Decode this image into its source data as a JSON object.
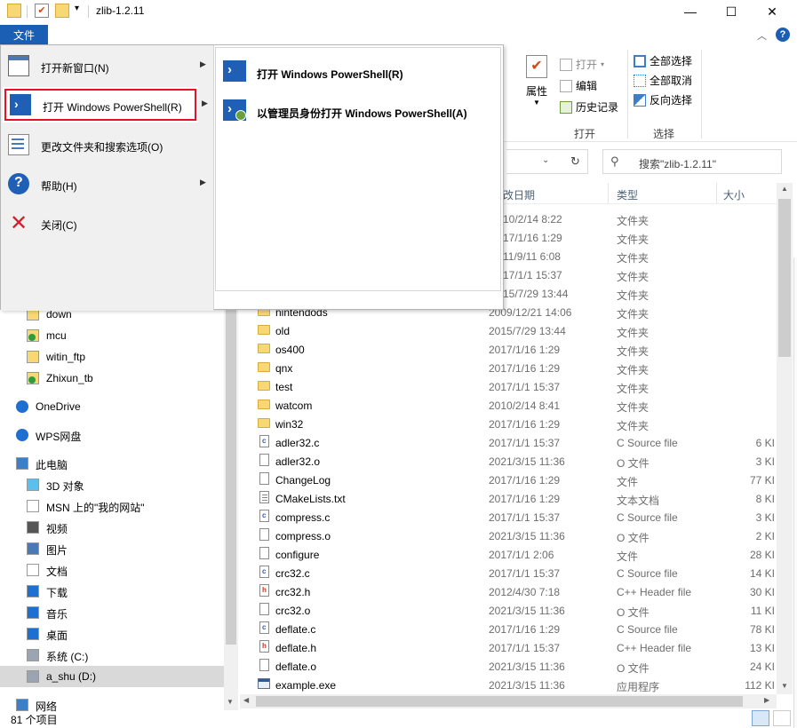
{
  "window": {
    "title": "zlib-1.2.11",
    "controls": {
      "minimize": "—",
      "maximize": "☐",
      "close": "✕"
    }
  },
  "ribbon": {
    "file_tab": "文件",
    "groups": [
      {
        "label": "打开"
      },
      {
        "label": "选择"
      }
    ],
    "properties": "属性",
    "open": "打开",
    "edit": "编辑",
    "history": "历史记录",
    "select_all": "全部选择",
    "select_none": "全部取消",
    "invert": "反向选择"
  },
  "address": {
    "search_placeholder": "搜索\"zlib-1.2.11\""
  },
  "columns": {
    "date": "改日期",
    "type": "类型",
    "size": "大小"
  },
  "file_menu": {
    "items": [
      {
        "label": "打开新窗口(N)",
        "icon": "new-window-icon",
        "has_submenu": true
      },
      {
        "label": "打开 Windows PowerShell(R)",
        "icon": "powershell-icon",
        "has_submenu": true,
        "selected": true
      },
      {
        "label": "更改文件夹和搜索选项(O)",
        "icon": "folder-options-icon",
        "has_submenu": false
      },
      {
        "label": "帮助(H)",
        "icon": "help-icon",
        "has_submenu": true
      },
      {
        "label": "关闭(C)",
        "icon": "close-icon",
        "has_submenu": false
      }
    ],
    "submenu": [
      {
        "label": "打开 Windows PowerShell(R)",
        "icon": "powershell-icon"
      },
      {
        "label": "以管理员身份打开 Windows PowerShell(A)",
        "icon": "powershell-admin-icon"
      }
    ]
  },
  "rows": [
    {
      "name": "",
      "date": "10/2/14 8:22",
      "type": "文件夹",
      "size": "",
      "kind": "folder",
      "partial": true
    },
    {
      "name": "",
      "date": "17/1/16 1:29",
      "type": "文件夹",
      "size": "",
      "kind": "folder",
      "partial": true
    },
    {
      "name": "",
      "date": "11/9/11 6:08",
      "type": "文件夹",
      "size": "",
      "kind": "folder",
      "partial": true
    },
    {
      "name": "",
      "date": "17/1/1 15:37",
      "type": "文件夹",
      "size": "",
      "kind": "folder",
      "partial": true
    },
    {
      "name": "",
      "date": "15/7/29 13:44",
      "type": "文件夹",
      "size": "",
      "kind": "folder",
      "partial": true
    },
    {
      "name": "nintendods",
      "date": "2009/12/21 14:06",
      "type": "文件夹",
      "size": "",
      "kind": "folder"
    },
    {
      "name": "old",
      "date": "2015/7/29 13:44",
      "type": "文件夹",
      "size": "",
      "kind": "folder"
    },
    {
      "name": "os400",
      "date": "2017/1/16 1:29",
      "type": "文件夹",
      "size": "",
      "kind": "folder"
    },
    {
      "name": "qnx",
      "date": "2017/1/16 1:29",
      "type": "文件夹",
      "size": "",
      "kind": "folder"
    },
    {
      "name": "test",
      "date": "2017/1/1 15:37",
      "type": "文件夹",
      "size": "",
      "kind": "folder"
    },
    {
      "name": "watcom",
      "date": "2010/2/14 8:41",
      "type": "文件夹",
      "size": "",
      "kind": "folder"
    },
    {
      "name": "win32",
      "date": "2017/1/16 1:29",
      "type": "文件夹",
      "size": "",
      "kind": "folder"
    },
    {
      "name": "adler32.c",
      "date": "2017/1/1 15:37",
      "type": "C Source file",
      "size": "6 KI",
      "kind": "c"
    },
    {
      "name": "adler32.o",
      "date": "2021/3/15 11:36",
      "type": "O 文件",
      "size": "3 KI",
      "kind": "file"
    },
    {
      "name": "ChangeLog",
      "date": "2017/1/16 1:29",
      "type": "文件",
      "size": "77 KI",
      "kind": "file"
    },
    {
      "name": "CMakeLists.txt",
      "date": "2017/1/16 1:29",
      "type": "文本文档",
      "size": "8 KI",
      "kind": "txt"
    },
    {
      "name": "compress.c",
      "date": "2017/1/1 15:37",
      "type": "C Source file",
      "size": "3 KI",
      "kind": "c"
    },
    {
      "name": "compress.o",
      "date": "2021/3/15 11:36",
      "type": "O 文件",
      "size": "2 KI",
      "kind": "file"
    },
    {
      "name": "configure",
      "date": "2017/1/1 2:06",
      "type": "文件",
      "size": "28 KI",
      "kind": "file"
    },
    {
      "name": "crc32.c",
      "date": "2017/1/1 15:37",
      "type": "C Source file",
      "size": "14 KI",
      "kind": "c"
    },
    {
      "name": "crc32.h",
      "date": "2012/4/30 7:18",
      "type": "C++ Header file",
      "size": "30 KI",
      "kind": "h"
    },
    {
      "name": "crc32.o",
      "date": "2021/3/15 11:36",
      "type": "O 文件",
      "size": "11 KI",
      "kind": "file"
    },
    {
      "name": "deflate.c",
      "date": "2017/1/16 1:29",
      "type": "C Source file",
      "size": "78 KI",
      "kind": "c"
    },
    {
      "name": "deflate.h",
      "date": "2017/1/1 15:37",
      "type": "C++ Header file",
      "size": "13 KI",
      "kind": "h"
    },
    {
      "name": "deflate.o",
      "date": "2021/3/15 11:36",
      "type": "O 文件",
      "size": "24 KI",
      "kind": "file"
    },
    {
      "name": "example.exe",
      "date": "2021/3/15 11:36",
      "type": "应用程序",
      "size": "112 KI",
      "kind": "exe"
    }
  ],
  "nav": [
    {
      "label": "down",
      "icon": "folder-icon"
    },
    {
      "label": "mcu",
      "icon": "folder-synced-icon"
    },
    {
      "label": "witin_ftp",
      "icon": "folder-icon"
    },
    {
      "label": "Zhixun_tb",
      "icon": "folder-synced-icon"
    },
    {
      "label": "OneDrive",
      "icon": "cloud-icon"
    },
    {
      "label": "WPS网盘",
      "icon": "wps-cloud-icon"
    },
    {
      "label": "此电脑",
      "icon": "computer-icon"
    },
    {
      "label": "3D 对象",
      "icon": "3d-objects-icon"
    },
    {
      "label": "MSN 上的\"我的网站\"",
      "icon": "document-icon"
    },
    {
      "label": "视频",
      "icon": "video-icon"
    },
    {
      "label": "图片",
      "icon": "pictures-icon"
    },
    {
      "label": "文档",
      "icon": "documents-icon"
    },
    {
      "label": "下载",
      "icon": "download-icon"
    },
    {
      "label": "音乐",
      "icon": "music-icon"
    },
    {
      "label": "桌面",
      "icon": "desktop-icon"
    },
    {
      "label": "系统 (C:)",
      "icon": "drive-c-icon"
    },
    {
      "label": "a_shu (D:)",
      "icon": "drive-d-icon",
      "selected": true
    },
    {
      "label": "网络",
      "icon": "network-icon"
    }
  ],
  "status": {
    "count": "81 个项目"
  },
  "colors": {
    "accent": "#1a5fb4",
    "highlight_border": "#e81123",
    "folder": "#f8d775",
    "selected": "#cce8ff"
  }
}
